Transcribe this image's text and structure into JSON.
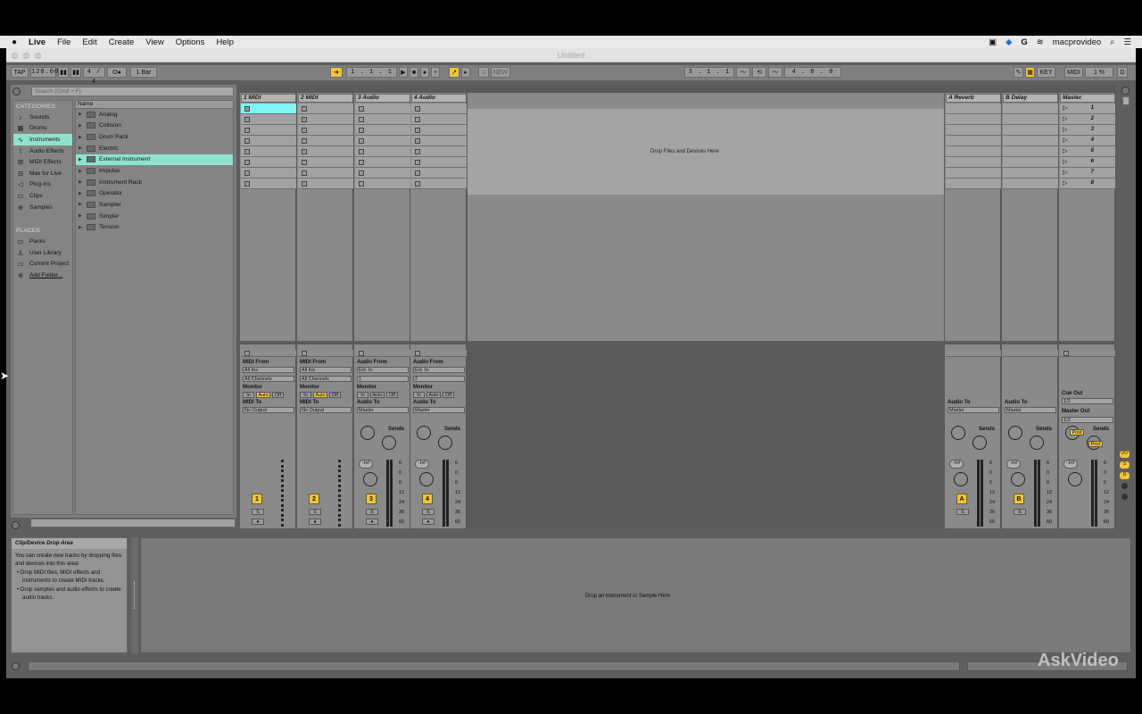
{
  "menubar": {
    "apple": "",
    "app": "Live",
    "items": [
      "File",
      "Edit",
      "Create",
      "View",
      "Options",
      "Help"
    ],
    "user": "macprovideo"
  },
  "window": {
    "title": "Untitled"
  },
  "transport": {
    "tap": "TAP",
    "tempo": "120.00",
    "time_sig": "4 / 4",
    "metronome": "O●",
    "quantize": "1 Bar",
    "position": "1 . 1 . 1",
    "new": "NEW",
    "loop_start": "3 . 1 . 1",
    "loop_length": "4 . 0 . 0",
    "key": "KEY",
    "midi": "MIDI",
    "cpu": "1 %",
    "disk": "D"
  },
  "browser": {
    "search_placeholder": "Search (Cmd + F)",
    "categories_header": "CATEGORIES",
    "categories": [
      {
        "label": "Sounds",
        "icon": "♪"
      },
      {
        "label": "Drums",
        "icon": "▦"
      },
      {
        "label": "Instruments",
        "icon": "∿"
      },
      {
        "label": "Audio Effects",
        "icon": "⌇"
      },
      {
        "label": "MIDI Effects",
        "icon": "⊞"
      },
      {
        "label": "Max for Live",
        "icon": "⊟"
      },
      {
        "label": "Plug-ins",
        "icon": "◁"
      },
      {
        "label": "Clips",
        "icon": "▭"
      },
      {
        "label": "Samples",
        "icon": "⊕"
      }
    ],
    "places_header": "PLACES",
    "places": [
      {
        "label": "Packs",
        "icon": "▭"
      },
      {
        "label": "User Library",
        "icon": "♙"
      },
      {
        "label": "Current Project",
        "icon": "▭"
      },
      {
        "label": "Add Folder...",
        "icon": "⊕"
      }
    ],
    "name_header": "Name",
    "items": [
      "Analog",
      "Collision",
      "Drum Rack",
      "Electric",
      "External Instrument",
      "Impulse",
      "Instrument Rack",
      "Operator",
      "Sampler",
      "Simpler",
      "Tension"
    ]
  },
  "session": {
    "tracks": [
      {
        "name": "1 MIDI",
        "num": "1"
      },
      {
        "name": "2 MIDI",
        "num": "2"
      },
      {
        "name": "3 Audio",
        "num": "3"
      },
      {
        "name": "4 Audio",
        "num": "4"
      }
    ],
    "returns": [
      {
        "name": "A Reverb",
        "num": "A"
      },
      {
        "name": "B Delay",
        "num": "B"
      }
    ],
    "master": {
      "name": "Master",
      "scenes": [
        "1",
        "2",
        "3",
        "4",
        "5",
        "6",
        "7",
        "8"
      ]
    },
    "drop_hint": "Drop Files and Devices Here",
    "io": {
      "midi_from": "MIDI From",
      "all_ins": "All Ins",
      "all_channels": "All Channels",
      "monitor": "Monitor",
      "in": "In",
      "auto": "Auto",
      "off": "Off",
      "midi_to": "MIDI To",
      "no_output": "No Output",
      "audio_from": "Audio From",
      "ext_in": "Ext. In",
      "ch1": "1",
      "ch2": "2",
      "audio_to": "Audio To",
      "master": "Master",
      "sends": "Sends",
      "cue_out": "Cue Out",
      "cue_val": "1/2",
      "master_out": "Master Out",
      "master_out_val": "1/2",
      "post": "Post",
      "inf": "-Inf",
      "s": "S"
    },
    "meter_scale": [
      "6",
      "0",
      "6",
      "12",
      "24",
      "36",
      "60"
    ]
  },
  "info": {
    "title": "Clip/Device Drop Area",
    "body": "You can create new tracks by dropping files and devices into this area:",
    "bullets": [
      "Drop MIDI files, MIDI effects and instruments to create MIDI tracks.",
      "Drop samples and audio effects to create audio tracks."
    ]
  },
  "detail": {
    "hint": "Drop an Instrument or Sample Here"
  },
  "watermark": "AskVideo"
}
